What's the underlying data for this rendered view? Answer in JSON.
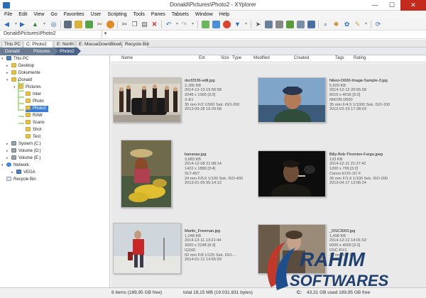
{
  "window": {
    "title": "Donald\\Pictures\\Photo2 - XYplorer"
  },
  "menu": [
    "File",
    "Edit",
    "View",
    "Go",
    "Favorites",
    "User",
    "Scripting",
    "Tools",
    "Panes",
    "Tabsets",
    "Window",
    "Help"
  ],
  "address": {
    "value": "Donald\\Pictures\\Photo2"
  },
  "tabs": [
    "This PC",
    "C: Photo2",
    "E: North",
    "E: MouseDownBlowUp",
    "Recycle Bin"
  ],
  "breadcrumb": [
    "Donald",
    "Pictures",
    "Photo2"
  ],
  "tree": {
    "items": [
      {
        "label": "This PC",
        "icon": "computer-icon"
      },
      {
        "label": "Desktop",
        "icon": "folder-icon"
      },
      {
        "label": "Dokumente",
        "icon": "folder-icon"
      },
      {
        "label": "Donald",
        "icon": "folder-icon"
      },
      {
        "label": "Pictures",
        "icon": "folder-icon"
      },
      {
        "label": "Inter",
        "icon": "folder-icon"
      },
      {
        "label": "Photo",
        "icon": "folder-icon"
      },
      {
        "label": "Photo2",
        "icon": "folder-icon"
      },
      {
        "label": "RAW",
        "icon": "folder-icon"
      },
      {
        "label": "Scans",
        "icon": "folder-icon"
      },
      {
        "label": "Shot",
        "icon": "folder-icon"
      },
      {
        "label": "Test",
        "icon": "folder-icon"
      },
      {
        "label": "System (C:)",
        "icon": "drive-icon"
      },
      {
        "label": "Volume (D:)",
        "icon": "drive-icon"
      },
      {
        "label": "Volume (E:)",
        "icon": "drive-icon"
      },
      {
        "label": "Network",
        "icon": "network-icon"
      },
      {
        "label": "VEGA",
        "icon": "computer-icon"
      },
      {
        "label": "Recycle Bin",
        "icon": "recycle-bin-icon"
      }
    ]
  },
  "columns": [
    "Name",
    "Ext",
    "Size",
    "Type",
    "Modified",
    "Created",
    "Tags",
    "Rating"
  ],
  "files": [
    {
      "name": "dscf2536-edit.jpg",
      "size": "2,186 KB",
      "date": "2014-12-13  15:55:58",
      "dims": "2048 x 1365  [3:2]",
      "camera": "X-E1",
      "exposure": "35 mm  F/2  1/500 Sek.  ISO-200",
      "taken": "2013-09-28  16:29:58"
    },
    {
      "name": "Nikon-D600-Image-Sample-3.jpg",
      "size": "5,929 KB",
      "date": "2014-12-12  20:55:58",
      "dims": "6016 x 4016  [3:2]",
      "camera": "NIKON D600",
      "exposure": "35 mm  F/4.5  1/1000 Sek.  ISO-100",
      "taken": "2012-02-23  17:28:03"
    },
    {
      "name": "bananas.jpg",
      "size": "3,683 KB",
      "date": "2014-12-08  21:08:14",
      "dims": "1422 x 1889  [3:4]",
      "camera": "SLT-A57",
      "exposure": "24 mm  F/5.6  1/100 Sek.  ISO-400",
      "taken": "2013-01-05  05:14:12"
    },
    {
      "name": "Billy-Bob-Thornton-Fargo.jpeg",
      "size": "133 KB",
      "date": "2014-12-11  21:27:42",
      "dims": "1200 x 799  [3:2]",
      "camera": "Canon EOS-1D X",
      "exposure": "35 mm  F/1.6  1/100 Sek.  ISO-200",
      "taken": "2013-04-17  13:06:24"
    },
    {
      "name": "Martin_Freeman.jpg",
      "size": "1,248 KB",
      "date": "2014-12-11  13:21:44",
      "dims": "3000 x 2248  [4:3]",
      "camera": "IQ160",
      "exposure": "50 mm  F/8  1/125 Sek.  ISO-...",
      "taken": "2014-01-12  14:55:59"
    },
    {
      "name": "_DSC3003.jpg",
      "size": "1,498 KB",
      "date": "2014-12-12  14:01:52",
      "dims": "6000 x 4000  [3:2]",
      "camera": "DSC-RX1",
      "exposure": "35 mm  F/2  1/...",
      "taken": "2013-..."
    }
  ],
  "status": {
    "items": "8 items (189,95 GB free)",
    "total": "total 18,15 MB (19.031.831 bytes)",
    "drive": "C:",
    "drive_info": "43,31 GB used   189,95 GB free"
  },
  "watermark": {
    "line1": "RAHIM",
    "line2": "SOFTWARES"
  },
  "colors": {
    "accent": "#3a7fd5",
    "crumb": "#6a7b94",
    "crumb_last": "#4a6188",
    "close": "#c42b1c"
  }
}
